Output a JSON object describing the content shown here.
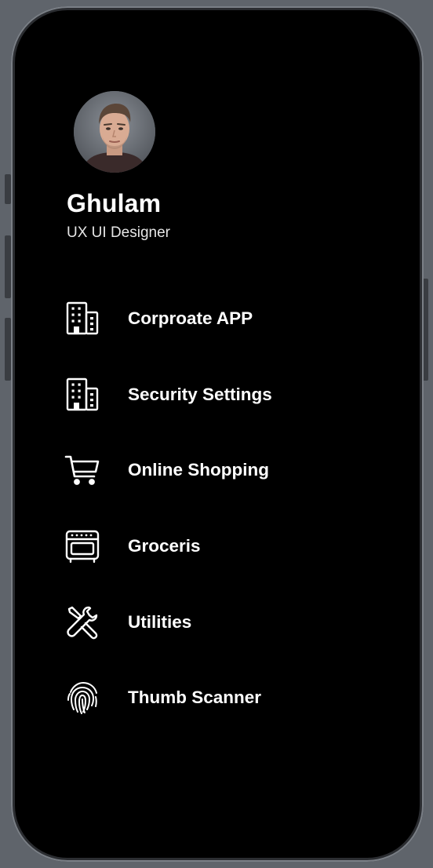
{
  "profile": {
    "name": "Ghulam",
    "role": "UX UI Designer",
    "avatar_icon": "profile-photo"
  },
  "menu": {
    "items": [
      {
        "label": "Corproate APP",
        "icon": "building-icon"
      },
      {
        "label": "Security Settings",
        "icon": "building-icon"
      },
      {
        "label": "Online Shopping",
        "icon": "shopping-cart-icon"
      },
      {
        "label": "Groceris",
        "icon": "oven-icon"
      },
      {
        "label": "Utilities",
        "icon": "tools-icon"
      },
      {
        "label": "Thumb Scanner",
        "icon": "fingerprint-icon"
      }
    ]
  },
  "colors": {
    "screen_background": "#000000",
    "text": "#ffffff",
    "device_frame": "#2b2d31",
    "backdrop": "#5f646b"
  }
}
